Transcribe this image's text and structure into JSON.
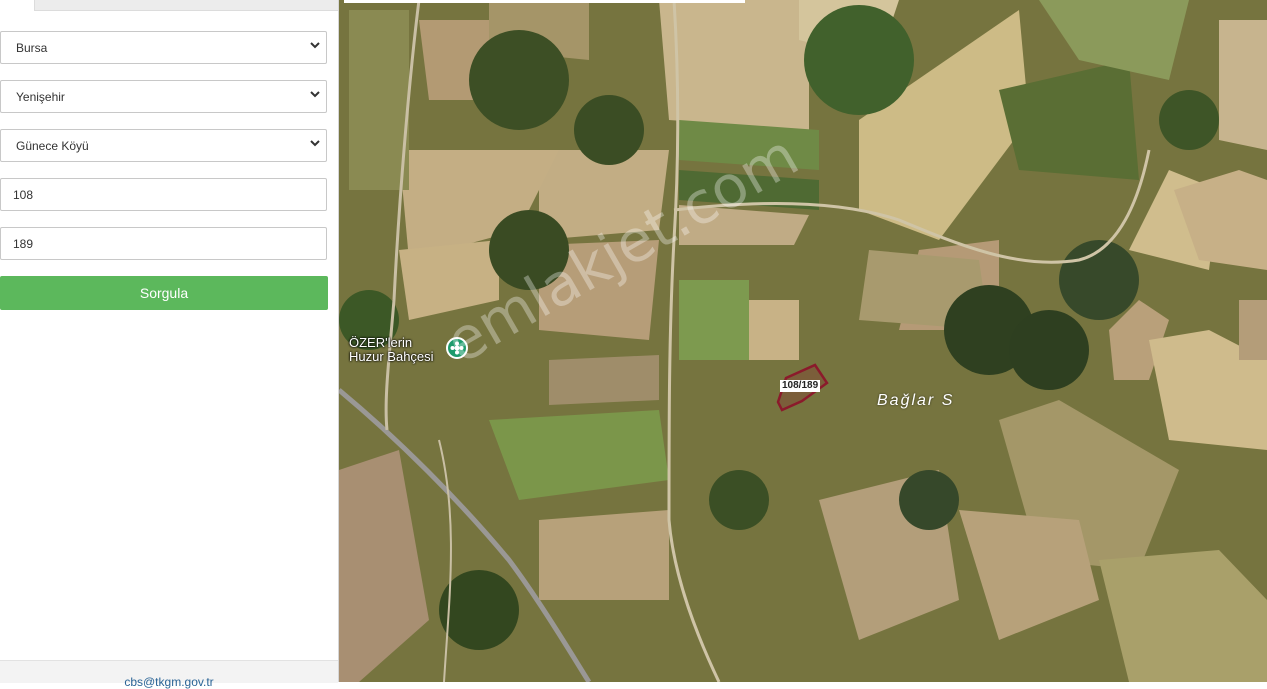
{
  "form": {
    "province": "Bursa",
    "district": "Yenişehir",
    "neighborhood": "Günece Köyü",
    "block_no": "108",
    "parcel_no": "189",
    "query_button": "Sorgula"
  },
  "footer": {
    "email": "cbs@tkgm.gov.tr"
  },
  "map": {
    "poi_name_line1": "ÖZER'lerin",
    "poi_name_line2": "Huzur Bahçesi",
    "parcel_label": "108/189",
    "place_label": "Bağlar S",
    "watermark": "emlakjet.com"
  },
  "colors": {
    "button": "#5cb85c",
    "parcel_outline": "#8b1a2b",
    "poi_icon": "#1e9b6c"
  }
}
